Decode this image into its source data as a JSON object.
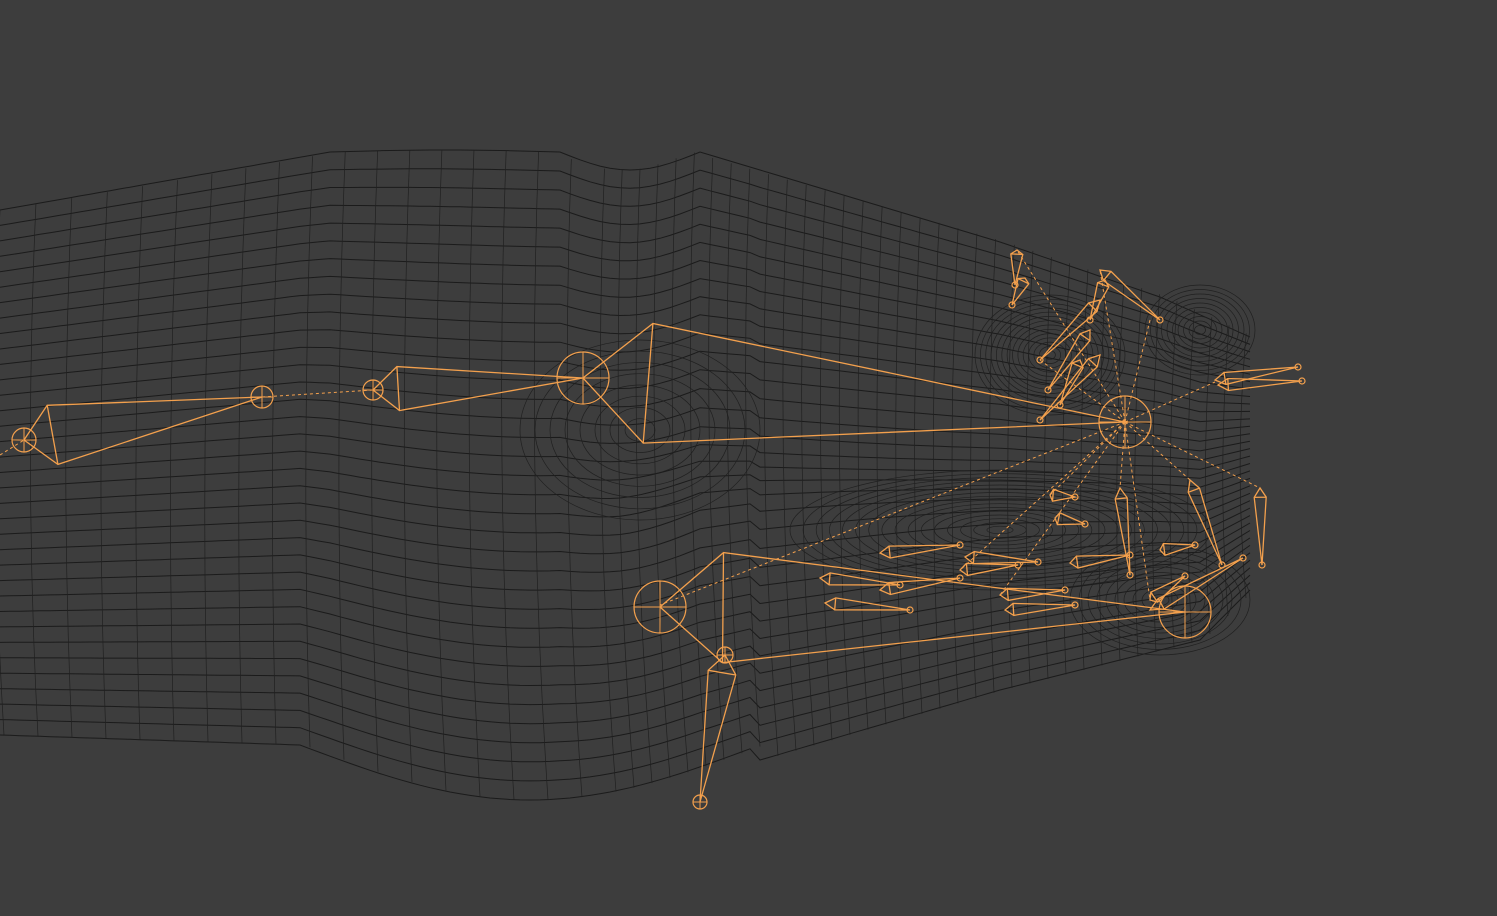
{
  "viewport": {
    "background": "#3d3d3d",
    "wire_color": "#1b1b1b",
    "armature_color": "#f3a04d",
    "mesh": "wireframe-mesh",
    "armature": "selected-armature"
  }
}
